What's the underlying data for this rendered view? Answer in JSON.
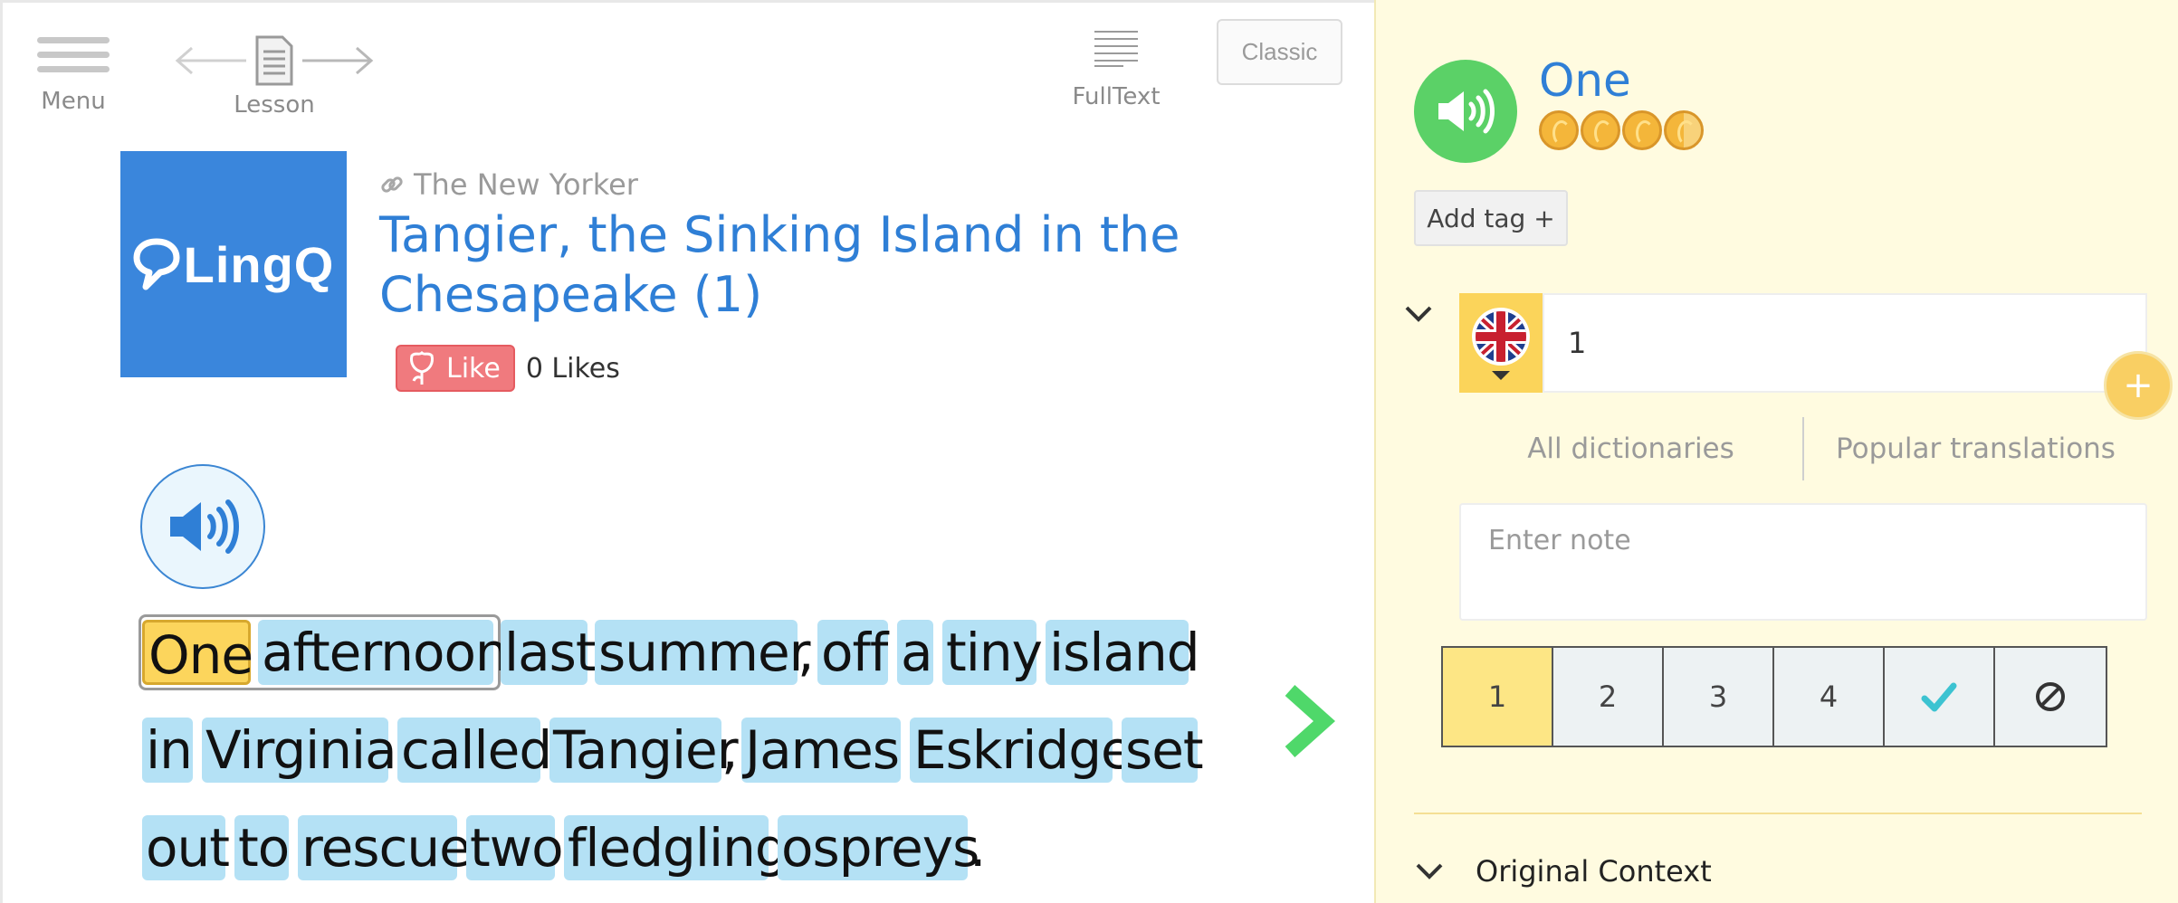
{
  "toolbar": {
    "menu_label": "Menu",
    "lesson_label": "Lesson",
    "fulltext_label": "FullText",
    "classic_label": "Classic"
  },
  "lesson": {
    "cover_logo": "LingQ",
    "source": "The New Yorker",
    "title": "Tangier, the Sinking Island in the Chesapeake (1)",
    "like_label": "Like",
    "likes_count": "0 Likes"
  },
  "text": {
    "lines": [
      [
        "One",
        "afternoon",
        "last",
        "summer",
        "off",
        "a",
        "tiny",
        "island"
      ],
      [
        "in",
        "Virginia",
        "called",
        "Tangier",
        "James",
        "Eskridge",
        "set"
      ],
      [
        "out",
        "to",
        "rescue",
        "two",
        "fledgling",
        "ospreys"
      ]
    ],
    "punct": [
      ",",
      ",",
      "."
    ]
  },
  "panel": {
    "term": "One",
    "coin_level": 3.5,
    "add_tag_label": "Add tag +",
    "meaning_value": "1",
    "add_button": "+",
    "dict_all": "All dictionaries",
    "dict_popular": "Popular translations",
    "note_placeholder": "Enter note",
    "status": [
      "1",
      "2",
      "3",
      "4"
    ],
    "status_selected": "1",
    "context_label": "Original Context"
  },
  "colors": {
    "accent_blue": "#2f7fd6",
    "word_highlight": "#b4e1f5",
    "selected_word": "#fcd55c",
    "panel_bg": "#fffbe0",
    "speaker_green": "#5bd167",
    "next_arrow": "#4fd86a"
  },
  "icons": {
    "menu": "hamburger-icon",
    "lesson": "document-icon",
    "fulltext": "lines-icon",
    "source": "link-icon",
    "like": "rose-icon",
    "audio": "speaker-icon",
    "next": "chevron-right-icon",
    "known": "checkmark-icon",
    "ignore": "ban-icon",
    "language": "uk-flag-icon"
  }
}
